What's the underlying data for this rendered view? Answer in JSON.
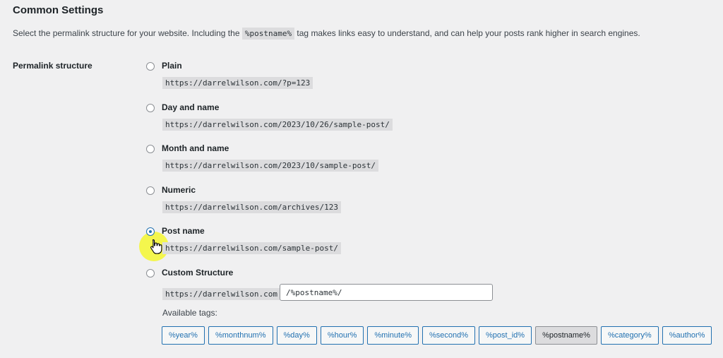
{
  "section": {
    "title": "Common Settings",
    "description_pre": "Select the permalink structure for your website. Including the",
    "description_code": "%postname%",
    "description_post": "tag makes links easy to understand, and can help your posts rank higher in search engines."
  },
  "permalink": {
    "label": "Permalink structure",
    "selected": "Post name",
    "options": [
      {
        "label": "Plain",
        "url": "https://darrelwilson.com/?p=123"
      },
      {
        "label": "Day and name",
        "url": "https://darrelwilson.com/2023/10/26/sample-post/"
      },
      {
        "label": "Month and name",
        "url": "https://darrelwilson.com/2023/10/sample-post/"
      },
      {
        "label": "Numeric",
        "url": "https://darrelwilson.com/archives/123"
      },
      {
        "label": "Post name",
        "url": "https://darrelwilson.com/sample-post/"
      },
      {
        "label": "Custom Structure",
        "url": "https://darrelwilson.com"
      }
    ],
    "custom_value": "/%postname%/",
    "available_tags_label": "Available tags:",
    "tags": [
      "%year%",
      "%monthnum%",
      "%day%",
      "%hour%",
      "%minute%",
      "%second%",
      "%post_id%",
      "%postname%",
      "%category%",
      "%author%"
    ],
    "active_tag": "%postname%"
  },
  "icons": {
    "cursor": "hand-pointer-icon"
  },
  "colors": {
    "accent": "#2271b1",
    "highlight": "#f4f728"
  }
}
